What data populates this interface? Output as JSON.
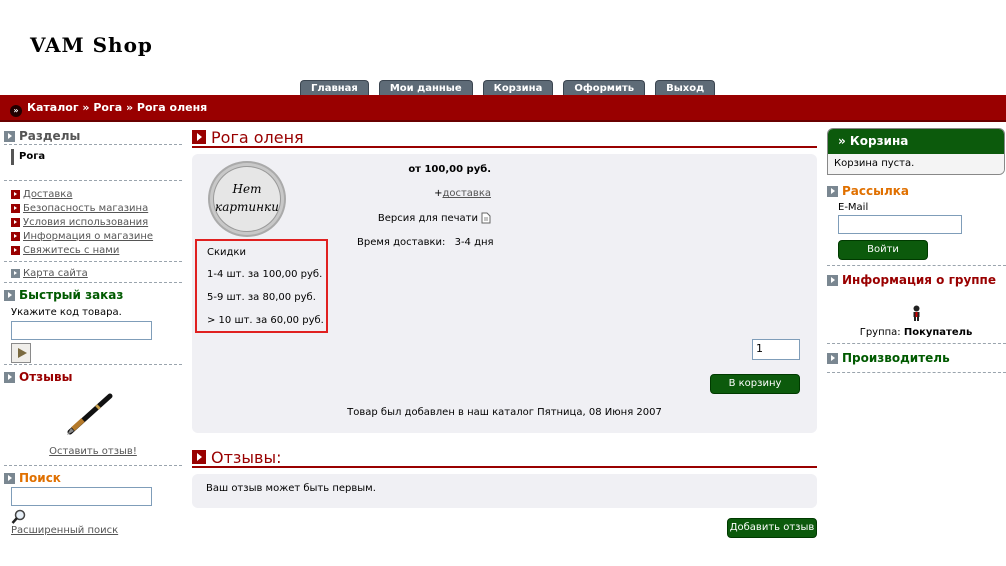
{
  "logo": "VAM Shop",
  "tabs": [
    "Главная",
    "Мои данные",
    "Корзина",
    "Оформить",
    "Выход"
  ],
  "breadcrumb": "Каталог » Рога » Рога оленя",
  "left": {
    "sections_title": "Разделы",
    "category": "Рога",
    "info_links": [
      "Доставка",
      "Безопасность магазина",
      "Условия использования",
      "Информация о магазине",
      "Свяжитесь с нами"
    ],
    "sitemap": "Карта сайта",
    "quick_title": "Быстрый заказ",
    "quick_label": "Укажите код товара.",
    "reviews_title": "Отзывы",
    "write_review": "Оставить отзыв!",
    "search_title": "Поиск",
    "adv_search": "Расширенный поиск"
  },
  "product": {
    "title": "Рога оленя",
    "no_image": [
      "Нет",
      "картинки"
    ],
    "price": "от 100,00 руб.",
    "delivery_prefix": "+",
    "delivery_link": "доставка",
    "print_version": "Версия для печати",
    "delivery_time_label": "Время доставки:",
    "delivery_time_value": "3-4 дня",
    "discounts_title": "Скидки",
    "discounts": [
      "1-4 шт. за 100,00 руб.",
      "5-9 шт. за 80,00 руб.",
      "> 10 шт. за 60,00 руб."
    ],
    "qty": "1",
    "cart_button": "В корзину",
    "added_note": "Товар был добавлен в наш каталог Пятница, 08 Июня 2007"
  },
  "reviews": {
    "title": "Отзывы:",
    "empty": "Ваш отзыв может быть первым.",
    "add_button": "Добавить отзыв"
  },
  "right": {
    "cart_title": "» Корзина",
    "cart_empty": "Корзина пуста.",
    "newsletter_title": "Рассылка",
    "email_label": "E-Mail",
    "login_button": "Войти",
    "group_title": "Информация о группе",
    "group_label": "Группа:",
    "group_value": "Покупатель",
    "manufacturer_title": "Производитель"
  },
  "colors": {
    "brand": "#990000",
    "green": "#005a00",
    "tab": "#5e6b77",
    "highlight": "#e02020"
  }
}
